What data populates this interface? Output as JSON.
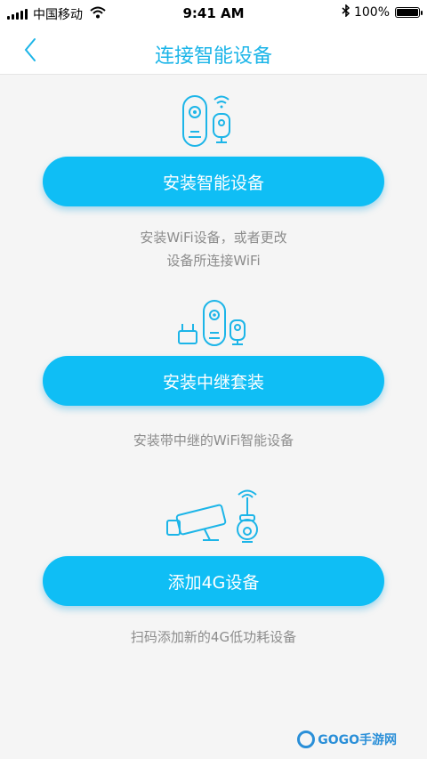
{
  "status_bar": {
    "carrier": "中国移动",
    "time": "9:41 AM",
    "battery": "100%",
    "battery_level": 1.0
  },
  "nav": {
    "title": "连接智能设备"
  },
  "sections": [
    {
      "button_label": "安装智能设备",
      "desc_line1": "安装WiFi设备，或者更改",
      "desc_line2": "设备所连接WiFi",
      "icon": "smart-doorbell-camera-icon"
    },
    {
      "button_label": "安装中继套装",
      "desc_line1": "安装带中继的WiFi智能设备",
      "icon": "repeater-kit-icon"
    },
    {
      "button_label": "添加4G设备",
      "desc_line1": "扫码添加新的4G低功耗设备",
      "icon": "4g-camera-icon"
    }
  ],
  "watermark": {
    "text": "GOGO手游网"
  },
  "colors": {
    "accent": "#1cb5e8",
    "button": "#0fbef5",
    "background": "#f5f5f5",
    "desc_text": "#8c8c8c"
  }
}
